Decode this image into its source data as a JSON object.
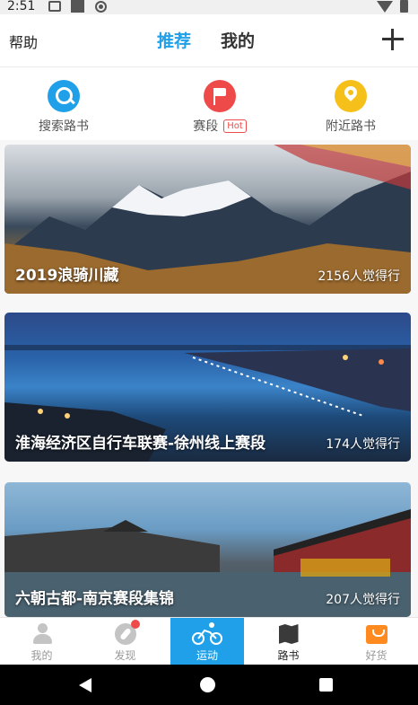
{
  "status_bar": {
    "time": "2:51"
  },
  "header": {
    "help_label": "帮助",
    "tabs": [
      {
        "label": "推荐",
        "active": true
      },
      {
        "label": "我的",
        "active": false
      }
    ],
    "add_icon": "plus-icon"
  },
  "quick_entries": [
    {
      "label": "搜索路书",
      "icon": "search-icon",
      "color": "#1fa0e8"
    },
    {
      "label": "赛段",
      "badge": "Hot",
      "icon": "flag-icon",
      "color": "#ef4a4a"
    },
    {
      "label": "附近路书",
      "icon": "location-pin-icon",
      "color": "#f6c01b"
    }
  ],
  "feed": [
    {
      "title": "2019浪骑川藏",
      "count": "2156人觉得行"
    },
    {
      "title": "淮海经济区自行车联赛-徐州线上赛段",
      "count": "174人觉得行"
    },
    {
      "title": "六朝古都-南京赛段集锦",
      "count": "207人觉得行"
    }
  ],
  "bottom_tabs": [
    {
      "label": "我的",
      "icon": "user-icon"
    },
    {
      "label": "发现",
      "icon": "compass-icon",
      "has_badge": true
    },
    {
      "label": "运动",
      "icon": "cycling-icon",
      "active": true
    },
    {
      "label": "路书",
      "icon": "map-icon"
    },
    {
      "label": "好货",
      "icon": "shopping-bag-icon"
    }
  ],
  "colors": {
    "accent": "#1fa0e8",
    "hot": "#ef4a4a"
  }
}
